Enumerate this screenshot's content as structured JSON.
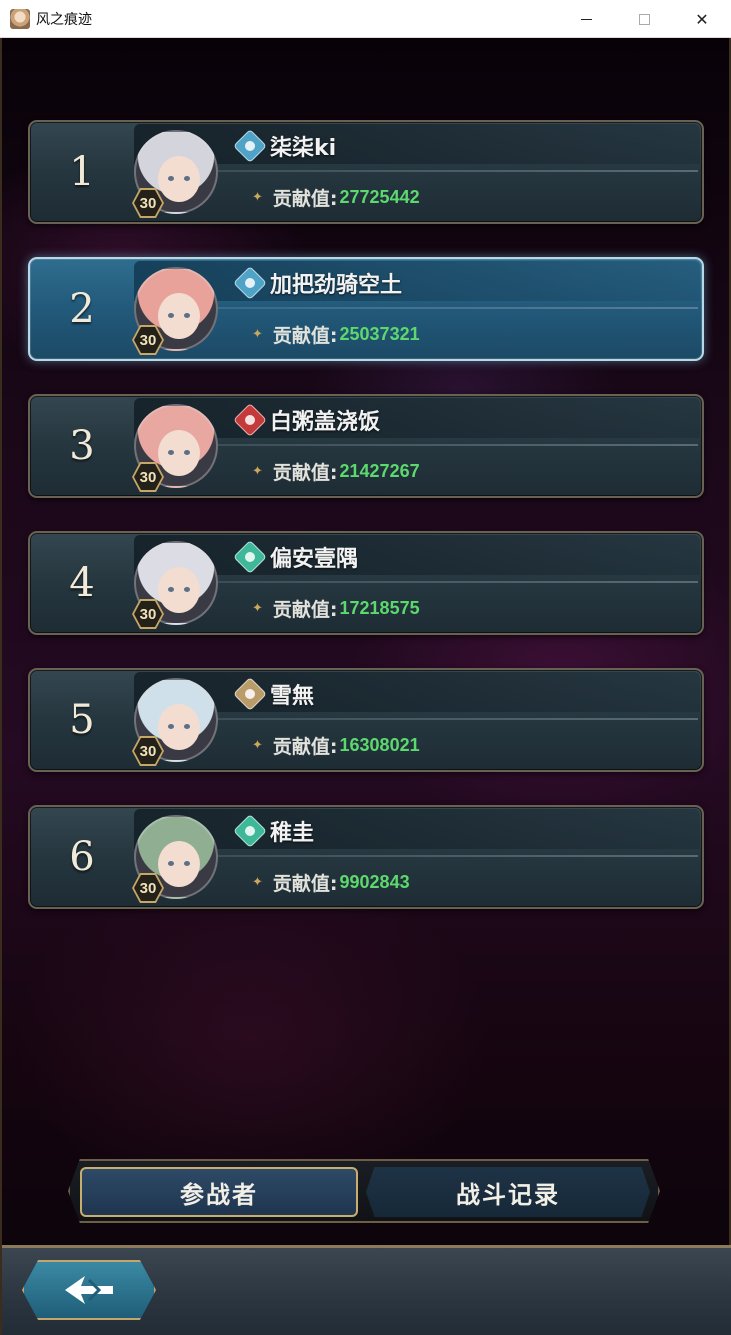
{
  "window": {
    "title": "风之痕迹",
    "minimize_icon": "minimize-icon",
    "maximize_icon": "maximize-icon",
    "close_icon": "close-icon",
    "close_glyph": "✕"
  },
  "ranking": {
    "contribution_label": "贡献值:",
    "rows": [
      {
        "rank": "1",
        "name": "柒柒ki",
        "level": "30",
        "contribution": "27725442",
        "element_icon": "hydro-element-icon",
        "element_color": "#4fa3c7",
        "hair_color": "#d4d4dc",
        "selected": false
      },
      {
        "rank": "2",
        "name": "加把劲骑空土",
        "level": "30",
        "contribution": "25037321",
        "element_icon": "hydro-element-icon",
        "element_color": "#4fa3c7",
        "hair_color": "#e8a29a",
        "selected": true
      },
      {
        "rank": "3",
        "name": "白粥盖浇饭",
        "level": "30",
        "contribution": "21427267",
        "element_icon": "pyro-element-icon",
        "element_color": "#c43a3a",
        "hair_color": "#e8a7a0",
        "selected": false
      },
      {
        "rank": "4",
        "name": "偏安壹隅",
        "level": "30",
        "contribution": "17218575",
        "element_icon": "anemo-element-icon",
        "element_color": "#3fb89a",
        "hair_color": "#dcdce4",
        "selected": false
      },
      {
        "rank": "5",
        "name": "雪無",
        "level": "30",
        "contribution": "16308021",
        "element_icon": "geo-element-icon",
        "element_color": "#b99c6a",
        "hair_color": "#cfe0ea",
        "selected": false
      },
      {
        "rank": "6",
        "name": "稚圭",
        "level": "30",
        "contribution": "9902843",
        "element_icon": "anemo-element-icon",
        "element_color": "#3fb89a",
        "hair_color": "#8fae92",
        "selected": false
      }
    ]
  },
  "tabs": {
    "participants_label": "参战者",
    "battle_log_label": "战斗记录",
    "active": "participants"
  },
  "bottom": {
    "back_icon": "back-arrow-icon"
  },
  "colors": {
    "contribution_value": "#5cd86e",
    "selected_row": "#22597a",
    "gold_border": "#c9ad6c"
  }
}
